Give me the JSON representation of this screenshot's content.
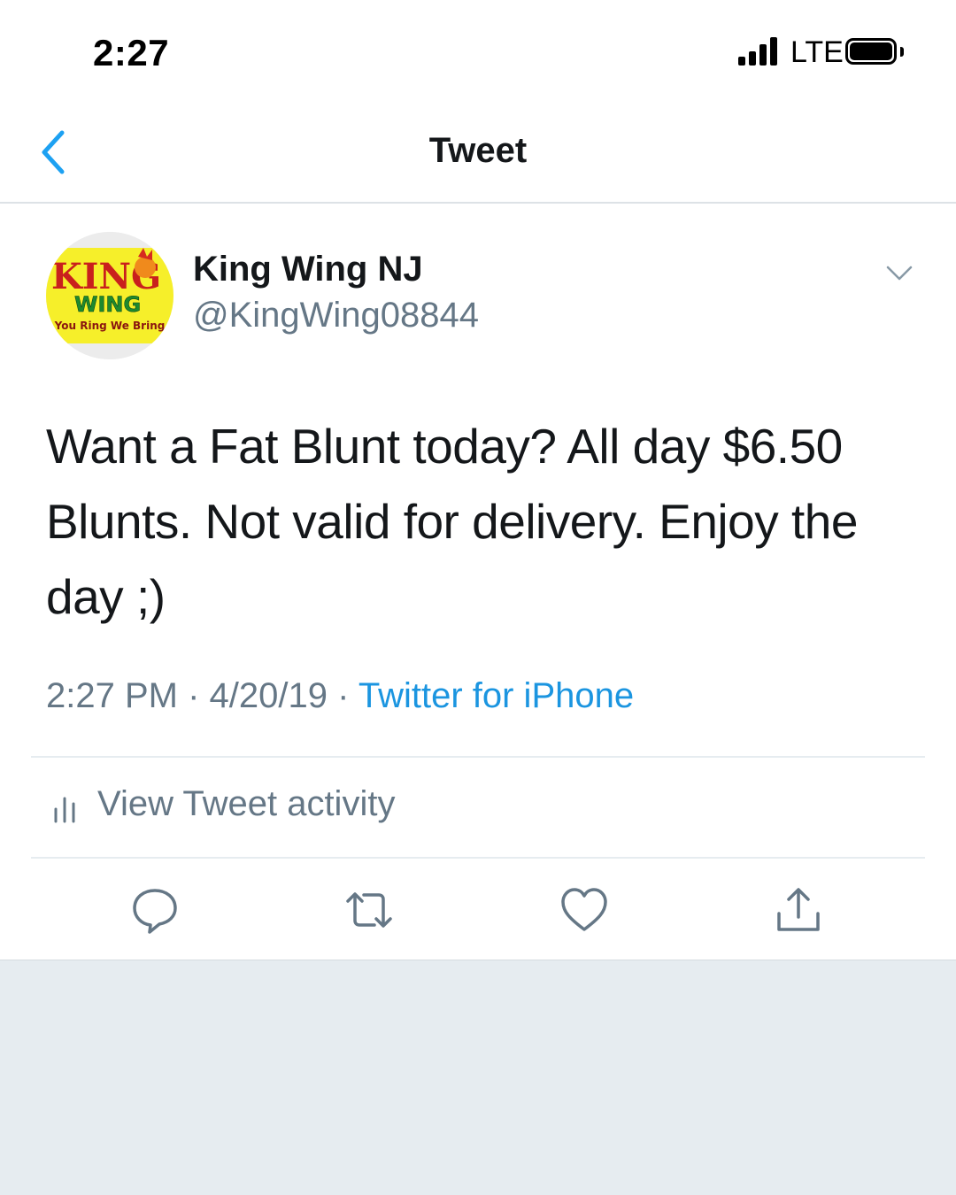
{
  "status_bar": {
    "time": "2:27",
    "network": "LTE"
  },
  "nav": {
    "title": "Tweet"
  },
  "tweet": {
    "author_name": "King Wing NJ",
    "author_handle": "@KingWing08844",
    "avatar_logo": {
      "line1": "KING",
      "line2": "WING",
      "tagline": "You Ring We Bring"
    },
    "text": "Want a Fat Blunt today? All day $6.50 Blunts. Not valid for delivery. Enjoy the day ;)",
    "time": "2:27 PM",
    "date": "4/20/19",
    "separator": "·",
    "source": "Twitter for iPhone"
  },
  "activity": {
    "label": "View Tweet activity"
  },
  "actions": [
    {
      "name": "reply",
      "icon": "reply-icon"
    },
    {
      "name": "retweet",
      "icon": "retweet-icon"
    },
    {
      "name": "like",
      "icon": "heart-icon"
    },
    {
      "name": "share",
      "icon": "share-icon"
    }
  ],
  "colors": {
    "accent": "#1da1f2",
    "link": "#1b95e0",
    "secondary_text": "#657786",
    "icon": "#657786"
  }
}
